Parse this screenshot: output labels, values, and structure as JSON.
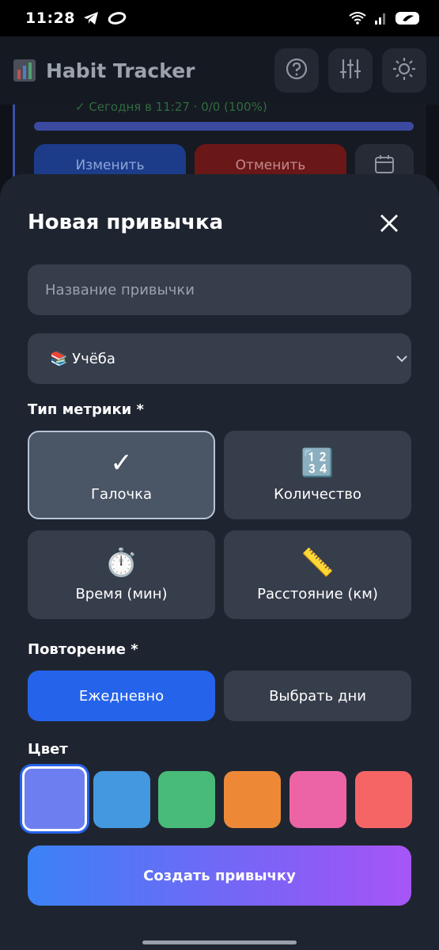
{
  "status_bar": {
    "time": "11:28",
    "battery": "38"
  },
  "app": {
    "title": "Habit Tracker"
  },
  "background_card": {
    "note": "✓ Сегодня в 11:27 · 0/0 (100%)",
    "edit_label": "Изменить",
    "cancel_label": "Отменить"
  },
  "sheet": {
    "title": "Новая привычка",
    "name_placeholder": "Название привычки",
    "category_value": "📚 Учёба",
    "metric_label": "Тип метрики *",
    "metrics": [
      {
        "label": "Галочка",
        "icon": "✓",
        "selected": true
      },
      {
        "label": "Количество",
        "icon": "🔢",
        "selected": false
      },
      {
        "label": "Время (мин)",
        "icon": "⏱️",
        "selected": false
      },
      {
        "label": "Расстояние (км)",
        "icon": "📏",
        "selected": false
      }
    ],
    "repeat_label": "Повторение *",
    "repeat_daily": "Ежедневно",
    "repeat_days": "Выбрать дни",
    "color_label": "Цвет",
    "colors": [
      "#6d7ff0",
      "#4498e0",
      "#48bb78",
      "#ed8936",
      "#ed64a6",
      "#f56565"
    ],
    "selected_color": "#6d7ff0",
    "create_label": "Создать привычку"
  }
}
